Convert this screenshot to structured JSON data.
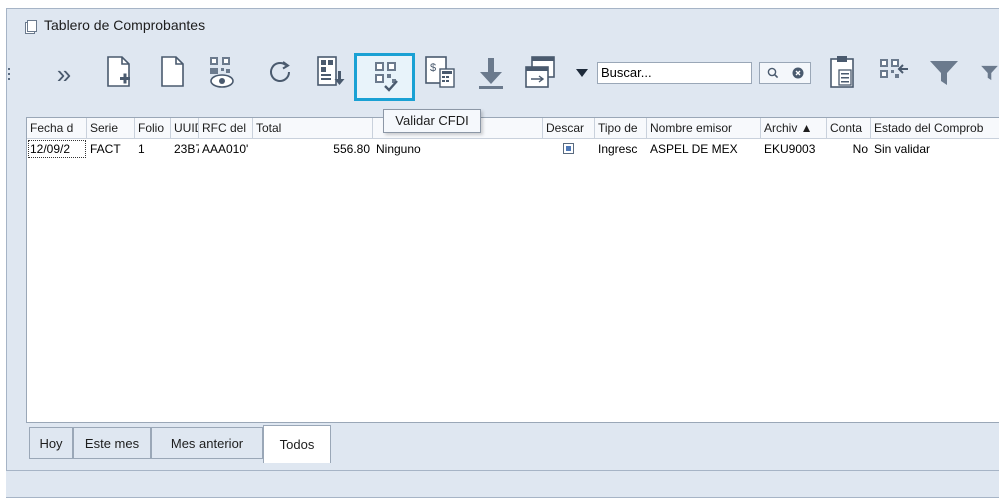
{
  "window": {
    "title": "Tablero de Comprobantes"
  },
  "toolbar": {
    "overflow_label": "»",
    "buttons": [
      {
        "name": "new-doc-icon"
      },
      {
        "name": "blank-doc-icon"
      },
      {
        "name": "qr-view-icon"
      },
      {
        "name": "refresh-icon"
      },
      {
        "name": "import-icon"
      },
      {
        "name": "validate-cfdi-icon"
      },
      {
        "name": "invoice-calc-icon"
      },
      {
        "name": "download-icon"
      },
      {
        "name": "window-layout-icon"
      },
      {
        "name": "dropdown-arrow-icon"
      },
      {
        "name": "clipboard-icon"
      },
      {
        "name": "qr-arrow-icon"
      },
      {
        "name": "filter-icon"
      }
    ],
    "tooltip": "Validar CFDI"
  },
  "search": {
    "placeholder": "Buscar..."
  },
  "table": {
    "columns": [
      "Fecha d",
      "Serie",
      "Folio",
      "UUID",
      "RFC del",
      "Total",
      "",
      "Descar",
      "Tipo de",
      "Nombre emisor",
      "Archiv ▲",
      "Conta",
      "Estado del Comprob"
    ],
    "rows": [
      {
        "fecha": "12/09/2",
        "serie": "FACT",
        "folio": "1",
        "uuid": "23B7",
        "rfc": "AAA010'",
        "total": "556.80",
        "moneda": "Ninguno",
        "descargado": true,
        "tipo": "Ingresc",
        "emisor": "ASPEL DE MEX",
        "archivo": "EKU9003",
        "conta": "No",
        "estado": "Sin validar"
      }
    ]
  },
  "tabs": [
    "Hoy",
    "Este mes",
    "Mes anterior",
    "Todos"
  ],
  "active_tab": "Todos",
  "colors": {
    "accent": "#1aa1d4",
    "window_bg": "#dfe7f1",
    "icon": "#4a5a6e"
  }
}
